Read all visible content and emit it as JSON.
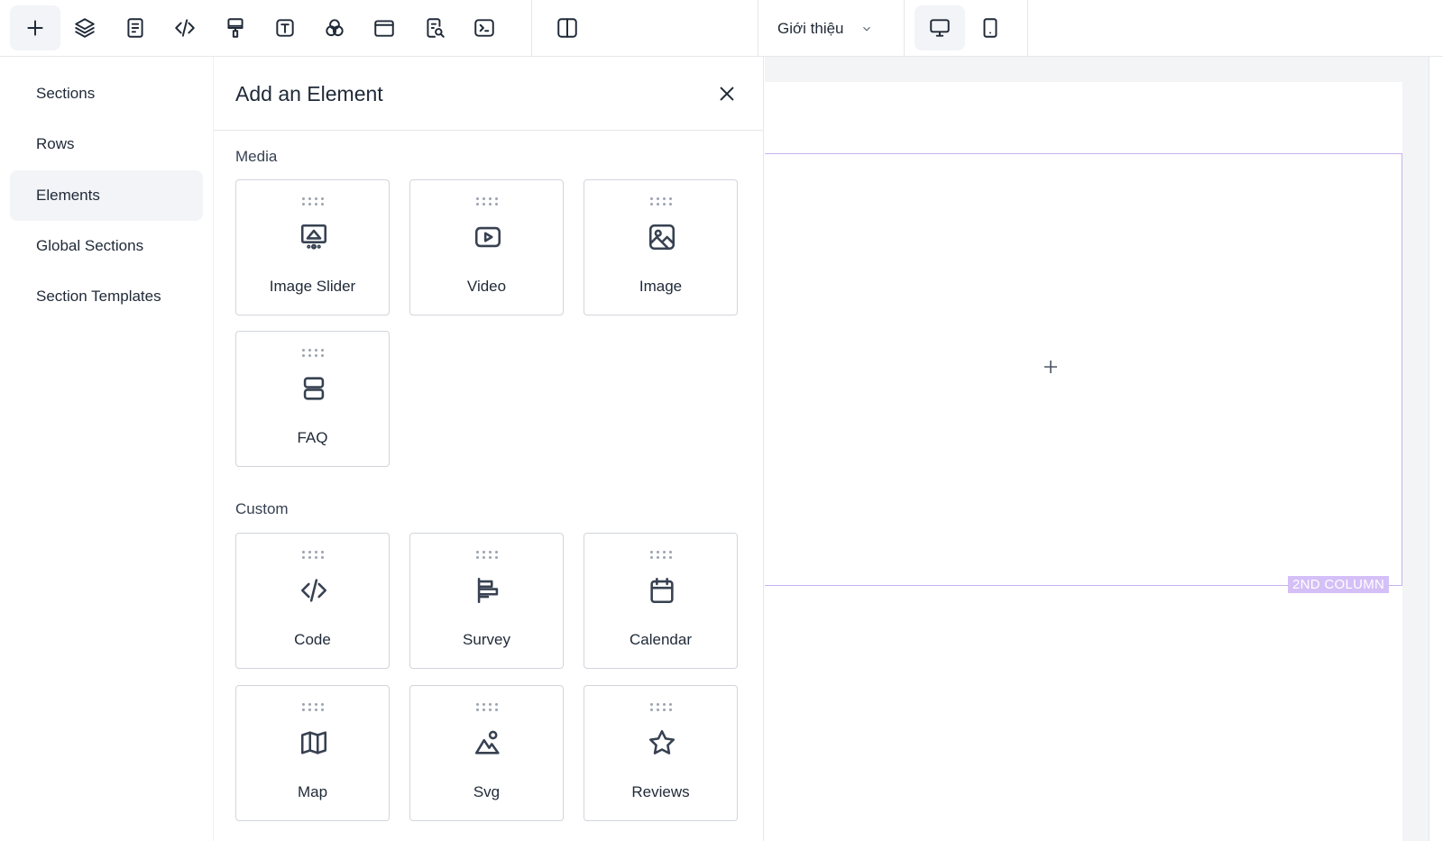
{
  "toolbar": {
    "buttons": [
      {
        "name": "add-icon",
        "tooltip": "Add"
      },
      {
        "name": "layers-icon"
      },
      {
        "name": "document-icon"
      },
      {
        "name": "code-icon"
      },
      {
        "name": "paint-brush-icon"
      },
      {
        "name": "text-icon"
      },
      {
        "name": "color-circles-icon"
      },
      {
        "name": "layout-icon"
      },
      {
        "name": "page-search-icon"
      },
      {
        "name": "terminal-icon"
      },
      {
        "name": "split-view-icon"
      }
    ],
    "page_selector": "Giới thiệu",
    "device_buttons": [
      {
        "name": "desktop-icon",
        "active": true
      },
      {
        "name": "tablet-icon",
        "active": false
      }
    ]
  },
  "leftnav": {
    "items": [
      {
        "label": "Sections",
        "active": false
      },
      {
        "label": "Rows",
        "active": false
      },
      {
        "label": "Elements",
        "active": true
      },
      {
        "label": "Global Sections",
        "active": false
      },
      {
        "label": "Section Templates",
        "active": false
      }
    ]
  },
  "panel": {
    "title": "Add an Element",
    "groups": [
      {
        "label": "Media",
        "items": [
          {
            "label": "Image Slider",
            "icon": "image-slider-icon"
          },
          {
            "label": "Video",
            "icon": "video-icon"
          },
          {
            "label": "Image",
            "icon": "image-icon"
          },
          {
            "label": "FAQ",
            "icon": "faq-icon"
          }
        ]
      },
      {
        "label": "Custom",
        "items": [
          {
            "label": "Code",
            "icon": "code-icon"
          },
          {
            "label": "Survey",
            "icon": "survey-icon"
          },
          {
            "label": "Calendar",
            "icon": "calendar-icon"
          },
          {
            "label": "Map",
            "icon": "map-icon"
          },
          {
            "label": "Svg",
            "icon": "svg-icon"
          },
          {
            "label": "Reviews",
            "icon": "star-icon"
          }
        ]
      }
    ]
  },
  "canvas": {
    "column_badge": "2ND COLUMN",
    "accent_color": "#c9b2f0"
  }
}
